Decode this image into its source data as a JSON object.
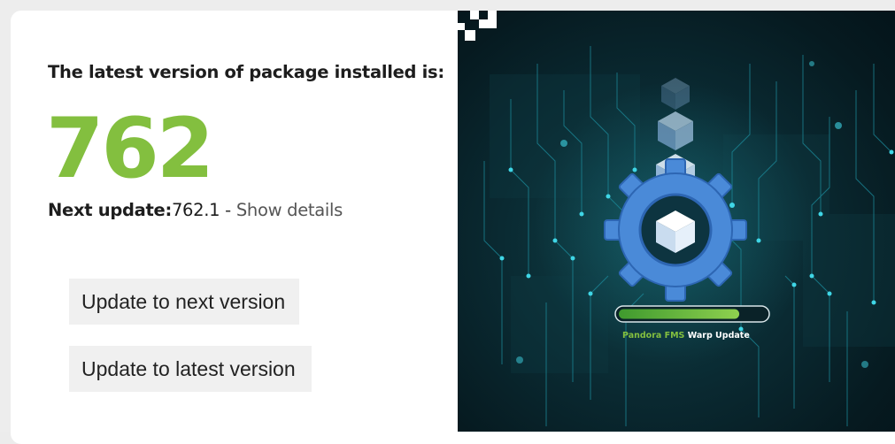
{
  "installed": {
    "heading": "The latest version of package installed is:",
    "version": "762"
  },
  "next_update": {
    "label": "Next update:",
    "value": "762.1",
    "separator": " - ",
    "details_link": "Show details"
  },
  "actions": {
    "next_label": "Update to next version",
    "latest_label": "Update to latest version"
  },
  "illustration": {
    "caption_brand": "Pandora FMS",
    "caption_rest": " Warp Update",
    "progress": 0.82,
    "accent_color": "#83bf3f",
    "gear_color": "#4a8ad8",
    "icons": [
      "gear-icon",
      "package-box-icon"
    ]
  }
}
